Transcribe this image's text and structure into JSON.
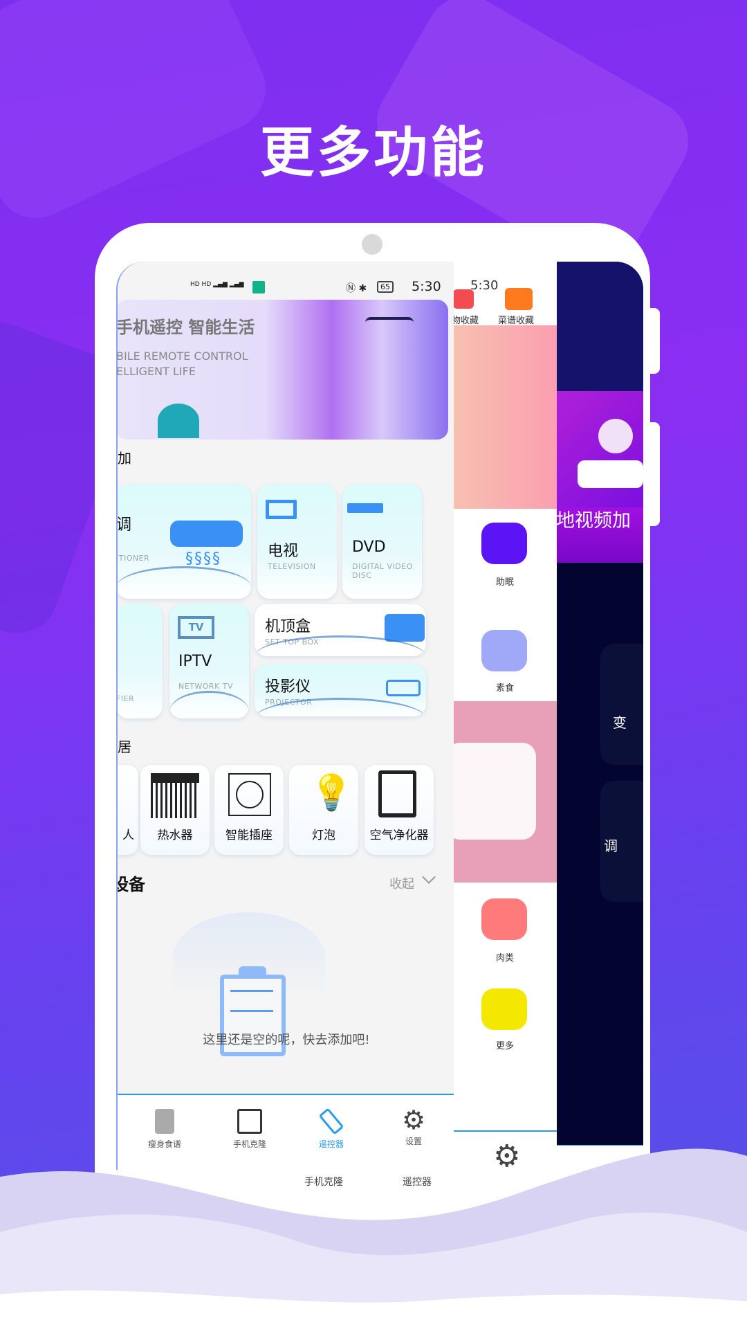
{
  "headline": "更多功能",
  "status_bar": {
    "time": "5:30",
    "battery": "65"
  },
  "front_screen": {
    "banner": {
      "title": "手机遥控 智能生活",
      "subtitle_line1": "BILE REMOTE CONTROL",
      "subtitle_line2": "ELLIGENT LIFE"
    },
    "section_add": "加",
    "remotes": [
      {
        "cn": "调",
        "en": "ITIONER"
      },
      {
        "cn": "电视",
        "en": "TELEVISION"
      },
      {
        "cn": "DVD",
        "en": "DIGITAL VIDEO DISC"
      },
      {
        "cn": "",
        "en": "FIER"
      },
      {
        "cn": "IPTV",
        "en": "NETWORK TV",
        "icon_text": "TV"
      },
      {
        "cn": "机顶盒",
        "en": "SET TOP BOX"
      },
      {
        "cn": "投影仪",
        "en": "PROJECTOR"
      }
    ],
    "section_home": "居",
    "smart_home": [
      "人",
      "热水器",
      "智能插座",
      "灯泡",
      "空气净化器"
    ],
    "section_devices": "设备",
    "collapse_label": "收起",
    "empty_text": "这里还是空的呢，快去添加吧!",
    "nav": [
      {
        "label": "瘦身食谱",
        "icon": "recipe-book-icon"
      },
      {
        "label": "手机克隆",
        "icon": "phone-clone-icon"
      },
      {
        "label": "遥控器",
        "icon": "remote-icon",
        "active": true
      },
      {
        "label": "设置",
        "icon": "gear-icon"
      }
    ],
    "accent": "#2a9af0"
  },
  "middle_screen": {
    "top_items": [
      "物收藏",
      "菜谱收藏"
    ],
    "categories": [
      {
        "label": "助眠",
        "color": "#5a14f5"
      },
      {
        "label": "素食",
        "color": "#a0a8f8"
      },
      {
        "label": "肉类",
        "color": "#ff7b7b"
      },
      {
        "label": "更多",
        "color": "#f5e800"
      }
    ]
  },
  "back_screen": {
    "banner_text": "本地视频加",
    "card1": "变",
    "card2": "调"
  },
  "under_nav": [
    "手机克隆",
    "遥控器"
  ]
}
